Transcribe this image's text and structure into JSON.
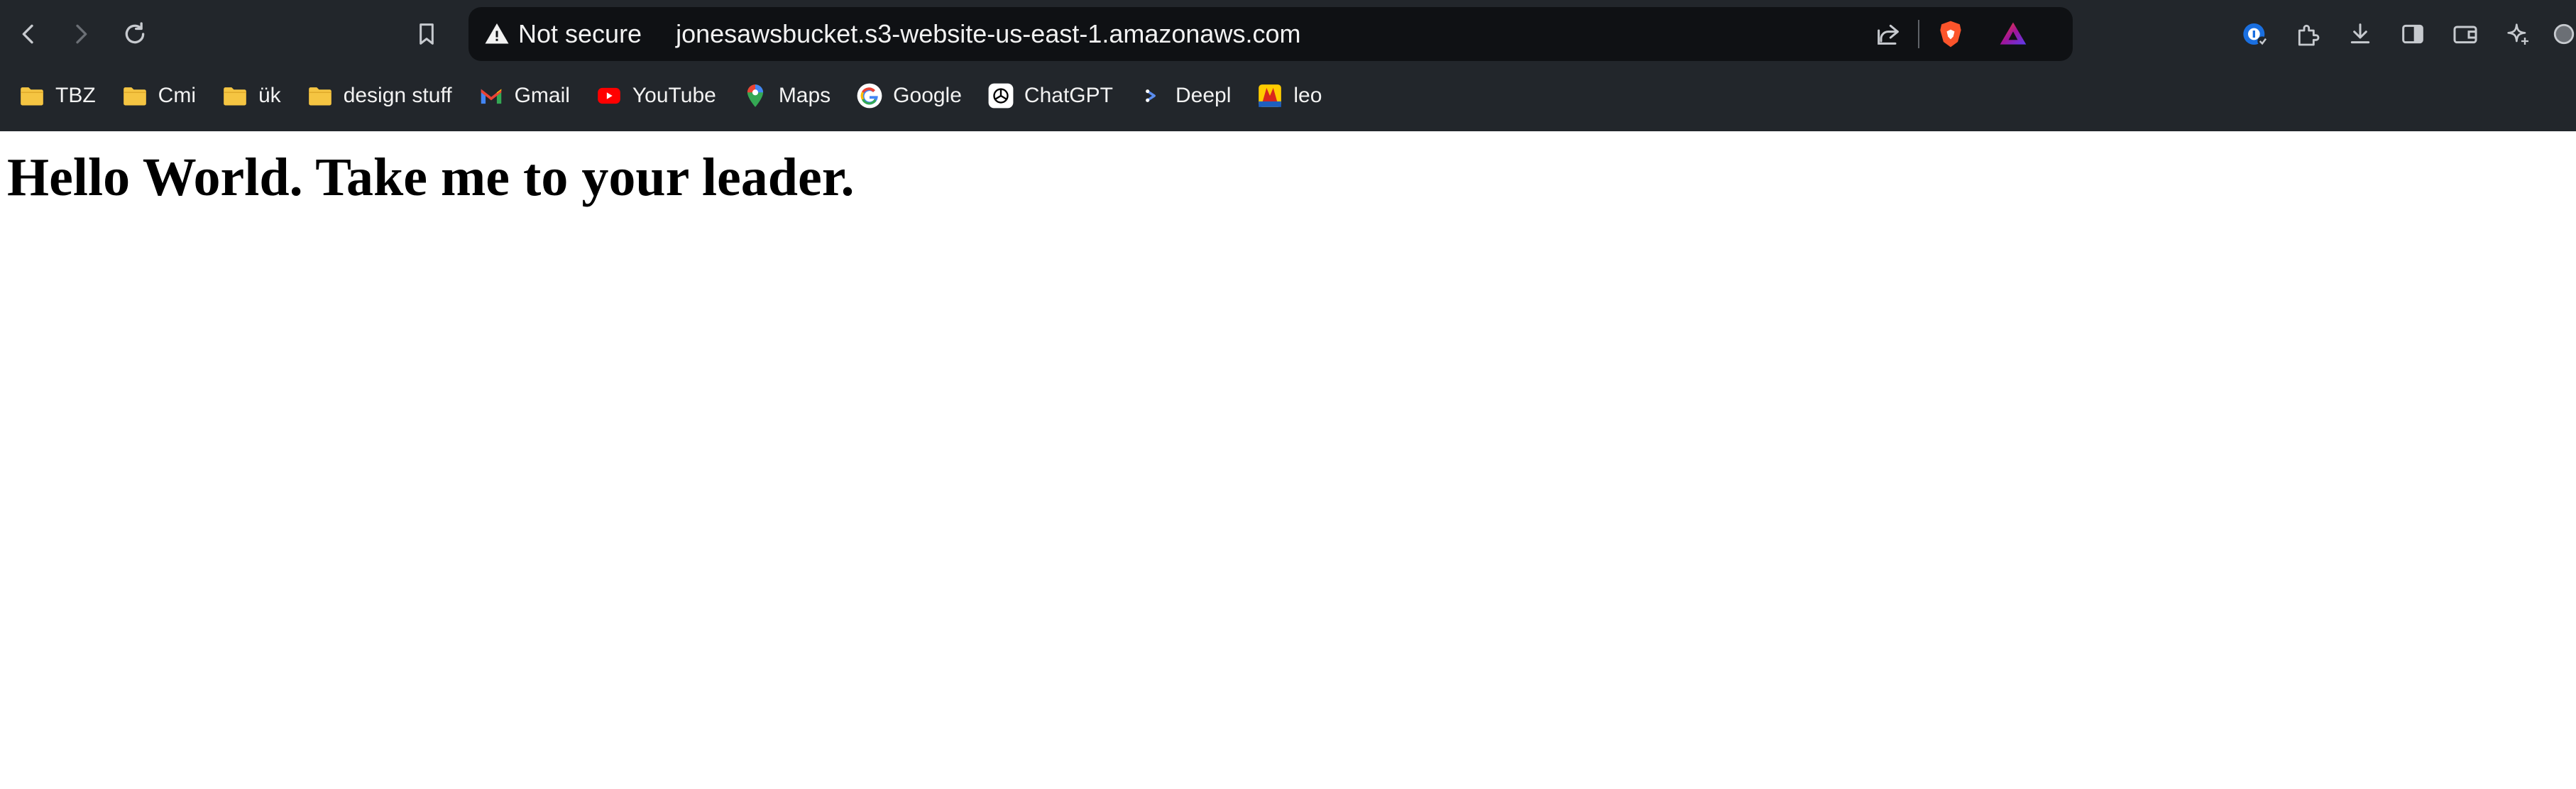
{
  "browser": {
    "address_bar": {
      "security_status": "Not secure",
      "url": "jonesawsbucket.s3-website-us-east-1.amazonaws.com"
    },
    "nav_icons": [
      "back-arrow-icon",
      "forward-arrow-icon",
      "reload-icon",
      "bookmark-icon"
    ],
    "omnibox_icons": [
      "share-icon",
      "brave-shields-icon",
      "brave-rewards-icon"
    ],
    "toolbar_icons": [
      "password-manager-icon",
      "extensions-icon",
      "download-icon",
      "sidebar-icon",
      "wallet-icon",
      "leo-ai-icon",
      "profile-avatar"
    ],
    "bookmarks": [
      {
        "label": "TBZ",
        "icon": "folder-icon"
      },
      {
        "label": "Cmi",
        "icon": "folder-icon"
      },
      {
        "label": "ük",
        "icon": "folder-icon"
      },
      {
        "label": "design stuff",
        "icon": "folder-icon"
      },
      {
        "label": "Gmail",
        "icon": "gmail-icon"
      },
      {
        "label": "YouTube",
        "icon": "youtube-icon"
      },
      {
        "label": "Maps",
        "icon": "maps-pin-icon"
      },
      {
        "label": "Google",
        "icon": "google-icon"
      },
      {
        "label": "ChatGPT",
        "icon": "chatgpt-icon"
      },
      {
        "label": "Deepl",
        "icon": "deepl-icon"
      },
      {
        "label": "leo",
        "icon": "leo-icon"
      }
    ],
    "colors": {
      "chrome_bg": "#22262b",
      "omnibox_bg": "#0f1114",
      "text": "#f2f2f2",
      "folder": "#f5c542"
    }
  },
  "page": {
    "heading": "Hello World. Take me to your leader."
  }
}
